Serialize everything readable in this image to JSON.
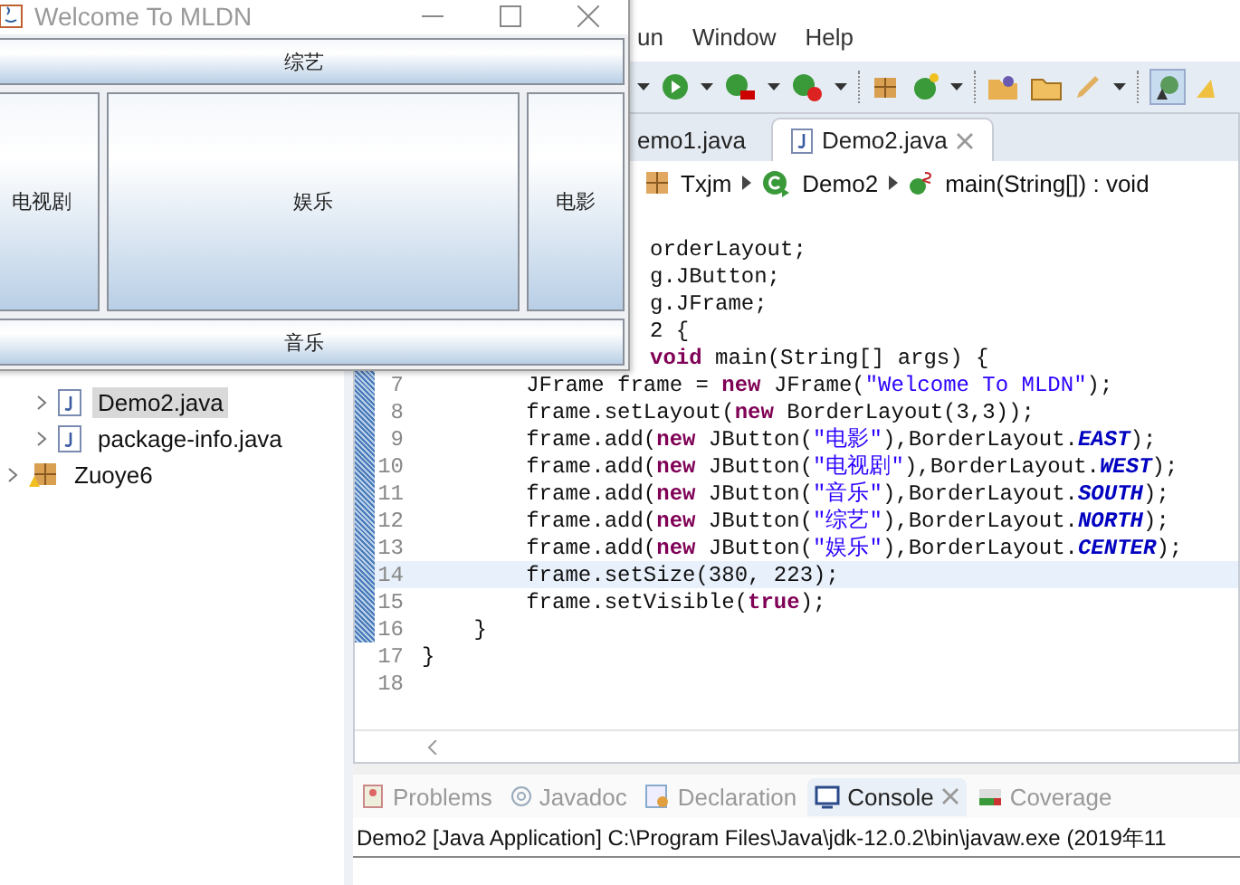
{
  "swing_window": {
    "title": "Welcome To MLDN",
    "buttons": [
      {
        "kind": "north",
        "label": "综艺"
      },
      {
        "kind": "west",
        "label": "电视剧"
      },
      {
        "kind": "center",
        "label": "娱乐"
      },
      {
        "kind": "east",
        "label": "电影"
      },
      {
        "kind": "south",
        "label": "音乐"
      }
    ]
  },
  "menu_bar": [
    "un",
    "Window",
    "Help"
  ],
  "package_explorer": {
    "items": [
      {
        "label": "Demo2.java",
        "kind": "file",
        "selected": true
      },
      {
        "label": "package-info.java",
        "kind": "file",
        "selected": false
      },
      {
        "label": "Zuoye6",
        "kind": "project",
        "selected": false
      }
    ]
  },
  "editor_tabs": [
    {
      "label": "emo1.java",
      "selected": false
    },
    {
      "label": "Demo2.java",
      "selected": true
    }
  ],
  "breadcrumb": [
    {
      "label": "Txjm",
      "kind": "package"
    },
    {
      "label": "Demo2",
      "kind": "class"
    },
    {
      "label": "main(String[]) : void",
      "kind": "method"
    }
  ],
  "code_lines": [
    {
      "current": false,
      "tokens": [
        {
          "t": "orderLayout;",
          "kind": "plain"
        }
      ]
    },
    {
      "current": false,
      "tokens": [
        {
          "t": "g.JButton;",
          "kind": "plain"
        }
      ]
    },
    {
      "current": false,
      "tokens": [
        {
          "t": "g.JFrame;",
          "kind": "plain"
        }
      ]
    },
    {
      "current": false,
      "tokens": [
        {
          "t": "2 {",
          "kind": "plain"
        }
      ]
    },
    {
      "current": false,
      "tokens": [
        {
          "t": "void",
          "kind": "kw"
        },
        {
          "t": " main(String[] args) {",
          "kind": "plain"
        }
      ]
    },
    {
      "number": "7",
      "current": false,
      "tokens": [
        {
          "t": "        JFrame frame = ",
          "kind": "plain"
        },
        {
          "t": "new",
          "kind": "kw"
        },
        {
          "t": " JFrame(",
          "kind": "plain"
        },
        {
          "t": "\"Welcome To MLDN\"",
          "kind": "str"
        },
        {
          "t": ");",
          "kind": "plain"
        }
      ]
    },
    {
      "number": "8",
      "current": false,
      "tokens": [
        {
          "t": "        frame.setLayout(",
          "kind": "plain"
        },
        {
          "t": "new",
          "kind": "kw"
        },
        {
          "t": " BorderLayout(3,3));",
          "kind": "plain"
        }
      ]
    },
    {
      "number": "9",
      "current": false,
      "tokens": [
        {
          "t": "        frame.add(",
          "kind": "plain"
        },
        {
          "t": "new",
          "kind": "kw"
        },
        {
          "t": " JButton(",
          "kind": "plain"
        },
        {
          "t": "\"电影\"",
          "kind": "str"
        },
        {
          "t": "),BorderLayout.",
          "kind": "plain"
        },
        {
          "t": "EAST",
          "kind": "const"
        },
        {
          "t": ");",
          "kind": "plain"
        }
      ]
    },
    {
      "number": "10",
      "current": false,
      "tokens": [
        {
          "t": "        frame.add(",
          "kind": "plain"
        },
        {
          "t": "new",
          "kind": "kw"
        },
        {
          "t": " JButton(",
          "kind": "plain"
        },
        {
          "t": "\"电视剧\"",
          "kind": "str"
        },
        {
          "t": "),BorderLayout.",
          "kind": "plain"
        },
        {
          "t": "WEST",
          "kind": "const"
        },
        {
          "t": ");",
          "kind": "plain"
        }
      ]
    },
    {
      "number": "11",
      "current": false,
      "tokens": [
        {
          "t": "        frame.add(",
          "kind": "plain"
        },
        {
          "t": "new",
          "kind": "kw"
        },
        {
          "t": " JButton(",
          "kind": "plain"
        },
        {
          "t": "\"音乐\"",
          "kind": "str"
        },
        {
          "t": "),BorderLayout.",
          "kind": "plain"
        },
        {
          "t": "SOUTH",
          "kind": "const"
        },
        {
          "t": ");",
          "kind": "plain"
        }
      ]
    },
    {
      "number": "12",
      "current": false,
      "tokens": [
        {
          "t": "        frame.add(",
          "kind": "plain"
        },
        {
          "t": "new",
          "kind": "kw"
        },
        {
          "t": " JButton(",
          "kind": "plain"
        },
        {
          "t": "\"综艺\"",
          "kind": "str"
        },
        {
          "t": "),BorderLayout.",
          "kind": "plain"
        },
        {
          "t": "NORTH",
          "kind": "const"
        },
        {
          "t": ");",
          "kind": "plain"
        }
      ]
    },
    {
      "number": "13",
      "current": false,
      "tokens": [
        {
          "t": "        frame.add(",
          "kind": "plain"
        },
        {
          "t": "new",
          "kind": "kw"
        },
        {
          "t": " JButton(",
          "kind": "plain"
        },
        {
          "t": "\"娱乐\"",
          "kind": "str"
        },
        {
          "t": "),BorderLayout.",
          "kind": "plain"
        },
        {
          "t": "CENTER",
          "kind": "const"
        },
        {
          "t": ");",
          "kind": "plain"
        }
      ]
    },
    {
      "number": "14",
      "current": true,
      "tokens": [
        {
          "t": "        frame.setSize(380, 223);",
          "kind": "plain"
        }
      ]
    },
    {
      "number": "15",
      "current": false,
      "tokens": [
        {
          "t": "        frame.setVisible(",
          "kind": "plain"
        },
        {
          "t": "true",
          "kind": "kw"
        },
        {
          "t": ");",
          "kind": "plain"
        }
      ]
    },
    {
      "number": "16",
      "current": false,
      "tokens": [
        {
          "t": "    }",
          "kind": "plain"
        }
      ]
    },
    {
      "number": "17",
      "current": false,
      "tokens": [
        {
          "t": "}",
          "kind": "plain"
        }
      ]
    },
    {
      "number": "18",
      "current": false
    }
  ],
  "bottom_tabs": [
    {
      "label": "Problems",
      "kind": "problems",
      "selected": false
    },
    {
      "label": "Javadoc",
      "kind": "javadoc",
      "selected": false
    },
    {
      "label": "Declaration",
      "kind": "declaration",
      "selected": false
    },
    {
      "label": "Console",
      "kind": "console",
      "selected": true
    },
    {
      "label": "Coverage",
      "kind": "coverage",
      "selected": false
    }
  ],
  "console_header": "Demo2 [Java Application] C:\\Program Files\\Java\\jdk-12.0.2\\bin\\javaw.exe (2019年11"
}
